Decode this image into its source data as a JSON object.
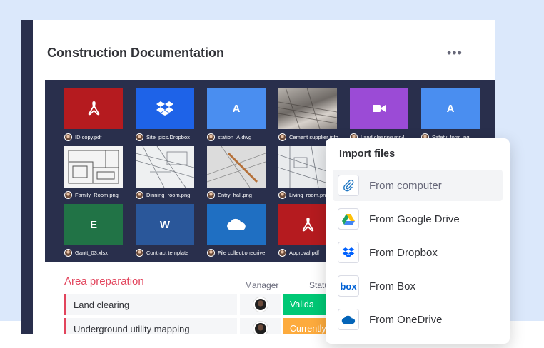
{
  "board": {
    "title": "Construction Documentation",
    "menu_label": "•••"
  },
  "colors": {
    "page_tint": "#dbe8fb",
    "sidebar": "#292f4c",
    "gallery_bg": "#292f4c",
    "pdf_red": "#b51b1f",
    "dropbox_blue": "#1e63e8",
    "doc_blue": "#4a8ef0",
    "video_purple": "#9b4bd6",
    "excel_green": "#217346",
    "word_blue": "#2a579a",
    "onedrive_blue": "#1f6fc2",
    "group_red": "#e2445c",
    "status_green": "#00c875",
    "status_orange": "#fdab3d"
  },
  "files": [
    {
      "name": "ID copy.pdf",
      "icon": "pdf-icon"
    },
    {
      "name": "Site_pics.Dropbox",
      "icon": "dropbox-icon"
    },
    {
      "name": "station_A.dwg",
      "icon": "doc-letter-icon",
      "letter": "A"
    },
    {
      "name": "Cement supplier info",
      "icon": "photo-thumbnail"
    },
    {
      "name": "Land clearing.mp4",
      "icon": "video-camera-icon"
    },
    {
      "name": "Safety_form.jpg",
      "icon": "doc-letter-icon",
      "letter": "A"
    },
    {
      "name": "Family_Room.png",
      "icon": "floorplan-thumbnail"
    },
    {
      "name": "Dinning_room.png",
      "icon": "blueprint-thumbnail"
    },
    {
      "name": "Entry_hall.png",
      "icon": "drafting-thumbnail"
    },
    {
      "name": "Living_room.png",
      "icon": "blueprint-thumbnail"
    },
    {
      "name": "Gantt_03.xlsx",
      "icon": "excel-icon",
      "letter": "E"
    },
    {
      "name": "Contract template",
      "icon": "word-icon",
      "letter": "W"
    },
    {
      "name": "File collect.onedrive",
      "icon": "onedrive-icon"
    },
    {
      "name": "Approval.pdf",
      "icon": "pdf-icon"
    }
  ],
  "table": {
    "group_title": "Area preparation",
    "col_manager": "Manager",
    "col_status": "Statu",
    "rows": [
      {
        "name": "Land clearing",
        "status": "Valida"
      },
      {
        "name": "Underground utility mapping",
        "status": "Currently"
      }
    ]
  },
  "import_popup": {
    "title": "Import files",
    "options": [
      {
        "label": "From computer",
        "icon": "paperclip-icon"
      },
      {
        "label": "From Google Drive",
        "icon": "google-drive-icon"
      },
      {
        "label": "From Dropbox",
        "icon": "dropbox-icon"
      },
      {
        "label": "From Box",
        "icon": "box-icon",
        "icon_text": "box"
      },
      {
        "label": "From OneDrive",
        "icon": "onedrive-icon"
      }
    ]
  }
}
